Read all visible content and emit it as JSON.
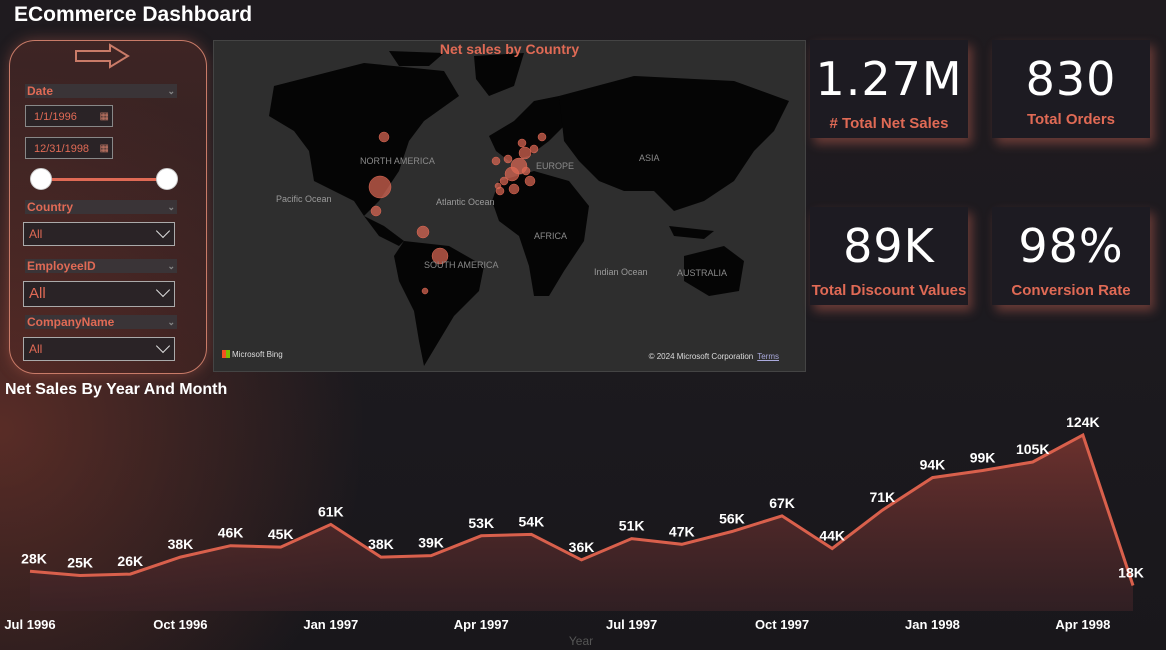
{
  "title": "ECommerce Dashboard",
  "filters": {
    "date_label": "Date",
    "date_start": "1/1/1996",
    "date_end": "12/31/1998",
    "country_label": "Country",
    "country_value": "All",
    "employee_label": "EmployeeID",
    "employee_value": "All",
    "company_label": "CompanyName",
    "company_value": "All"
  },
  "map": {
    "title": "Net sales by Country",
    "labels": {
      "north_america": "NORTH AMERICA",
      "europe": "EUROPE",
      "asia": "ASIA",
      "africa": "AFRICA",
      "south_america": "SOUTH AMERICA",
      "australia": "AUSTRALIA",
      "pacific": "Pacific Ocean",
      "atlantic": "Atlantic Ocean",
      "indian": "Indian Ocean"
    },
    "attribution": "Microsoft Bing",
    "copyright": "© 2024 Microsoft Corporation",
    "terms": "Terms",
    "bubble_color": "#e06a55"
  },
  "kpis": {
    "net_sales": {
      "value": "1.27M",
      "label": "# Total Net Sales"
    },
    "orders": {
      "value": "830",
      "label": "Total Orders"
    },
    "discount": {
      "value": "89K",
      "label": "Total Discount Values"
    },
    "conversion": {
      "value": "98%",
      "label": "Conversion Rate"
    }
  },
  "colors": {
    "accent": "#e06a55",
    "line": "#d9604c"
  },
  "chart_data": {
    "type": "area",
    "title": "Net Sales By Year And Month",
    "xlabel": "Year",
    "ylabel": "",
    "x": [
      "Jul 1996",
      "Aug 1996",
      "Sep 1996",
      "Oct 1996",
      "Nov 1996",
      "Dec 1996",
      "Jan 1997",
      "Feb 1997",
      "Mar 1997",
      "Apr 1997",
      "May 1997",
      "Jun 1997",
      "Jul 1997",
      "Aug 1997",
      "Sep 1997",
      "Oct 1997",
      "Nov 1997",
      "Dec 1997",
      "Jan 1998",
      "Feb 1998",
      "Mar 1998",
      "Apr 1998",
      "May 1998"
    ],
    "values": [
      28000,
      25000,
      26000,
      38000,
      46000,
      45000,
      61000,
      38000,
      39000,
      53000,
      54000,
      36000,
      51000,
      47000,
      56000,
      67000,
      44000,
      71000,
      94000,
      99000,
      105000,
      124000,
      18000
    ],
    "data_labels": [
      "28K",
      "25K",
      "26K",
      "38K",
      "46K",
      "45K",
      "61K",
      "38K",
      "39K",
      "53K",
      "54K",
      "36K",
      "51K",
      "47K",
      "56K",
      "67K",
      "44K",
      "71K",
      "94K",
      "99K",
      "105K",
      "124K",
      "18K"
    ],
    "x_ticks": [
      "Jul 1996",
      "Oct 1996",
      "Jan 1997",
      "Apr 1997",
      "Jul 1997",
      "Oct 1997",
      "Jan 1998",
      "Apr 1998"
    ],
    "x_tick_index": [
      0,
      3,
      6,
      9,
      12,
      15,
      18,
      21
    ]
  }
}
